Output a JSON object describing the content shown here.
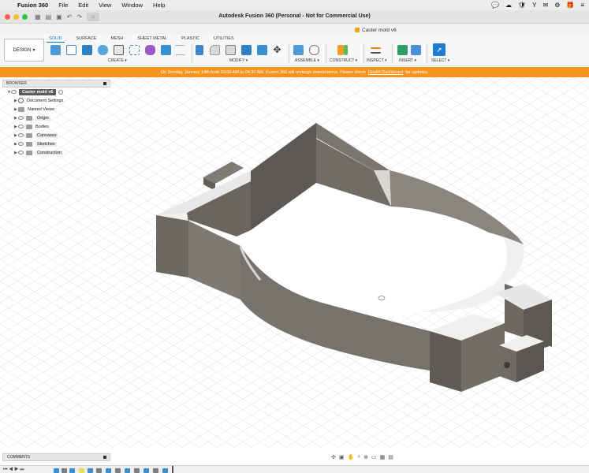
{
  "menubar": {
    "app": "Fusion 360",
    "items": [
      "File",
      "Edit",
      "View",
      "Window",
      "Help"
    ]
  },
  "window": {
    "title": "Autodesk Fusion 360 (Personal - Not for Commercial Use)"
  },
  "document_tab": {
    "label": "Caster mold v6"
  },
  "toolbar": {
    "workspace": "DESIGN",
    "tabs": [
      "SOLID",
      "SURFACE",
      "MESH",
      "SHEET METAL",
      "PLASTIC",
      "UTILITIES"
    ],
    "active_tab": "SOLID",
    "groups": [
      "CREATE",
      "MODIFY",
      "ASSEMBLE",
      "CONSTRUCT",
      "INSPECT",
      "INSERT",
      "SELECT"
    ]
  },
  "banner": {
    "text": "On Sunday, January 14th from 03:00 AM to 04:30 AM, Fusion 360 will undergo maintenance. Please check",
    "link": "Health Dashboard",
    "suffix": "for updates."
  },
  "browser": {
    "title": "BROWSER",
    "root": "Caster mold v6",
    "items": [
      {
        "label": "Document Settings",
        "icon": "gear-icon"
      },
      {
        "label": "Named Views",
        "icon": "folder-icon"
      },
      {
        "label": "Origin",
        "icon": "folder-icon"
      },
      {
        "label": "Bodies",
        "icon": "folder-icon"
      },
      {
        "label": "Canvases",
        "icon": "folder-icon"
      },
      {
        "label": "Sketches",
        "icon": "folder-icon"
      },
      {
        "label": "Construction",
        "icon": "folder-icon"
      }
    ]
  },
  "comments": {
    "title": "COMMENTS"
  },
  "colors": {
    "accent": "#0b72c4",
    "banner": "#f7941d",
    "model_top": "#f0efed",
    "model_side_dark": "#5d5a55",
    "model_side_mid": "#7c7872"
  }
}
